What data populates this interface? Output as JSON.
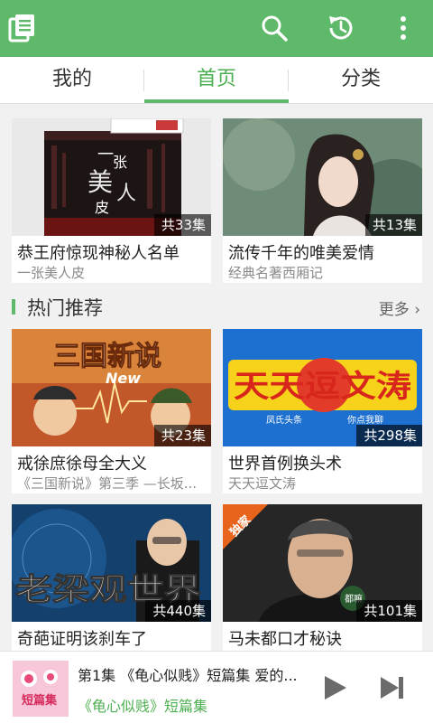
{
  "colors": {
    "primary": "#5fb96b",
    "tab_active": "#4caf50",
    "badge_bg": "#000000a0"
  },
  "appbar": {
    "icons": [
      "book-icon",
      "search-icon",
      "history-icon",
      "more-vert-icon"
    ]
  },
  "tabs": [
    {
      "label": "我的",
      "active": false
    },
    {
      "label": "首页",
      "active": true
    },
    {
      "label": "分类",
      "active": false
    }
  ],
  "featured": [
    {
      "title": "恭王府惊现神秘人名单",
      "subtitle": "一张美人皮",
      "count": "共33集",
      "cover_text": [
        "一",
        "张",
        "美",
        "人",
        "皮"
      ]
    },
    {
      "title": "流传千年的唯美爱情",
      "subtitle": "经典名著西厢记",
      "count": "共13集"
    }
  ],
  "section": {
    "title": "热门推荐",
    "more": "更多"
  },
  "hot": [
    {
      "title": "戒徐庶徐母全大义",
      "subtitle": "《三国新说》第三季 —长坂...",
      "count": "共23集",
      "cover_text": "三国新说",
      "cover_sub": "New"
    },
    {
      "title": "世界首例换头术",
      "subtitle": "天天逗文涛",
      "count": "共298集",
      "cover_text": "天天逗文涛",
      "cover_sub_left": "凤氏头条",
      "cover_sub_right": "你点我聊"
    },
    {
      "title": "奇葩证明该刹车了",
      "subtitle": "",
      "count": "共440集",
      "cover_text": "老梁观世界"
    },
    {
      "title": "马未都口才秘诀",
      "subtitle": "",
      "count": "共101集",
      "cover_badge": "独家",
      "cover_seal": "都嘛"
    }
  ],
  "player": {
    "title": "第1集 《龟心似贱》短篇集 爱的...",
    "subtitle": "《龟心似贱》短篇集",
    "cover_text": "短篇集"
  }
}
